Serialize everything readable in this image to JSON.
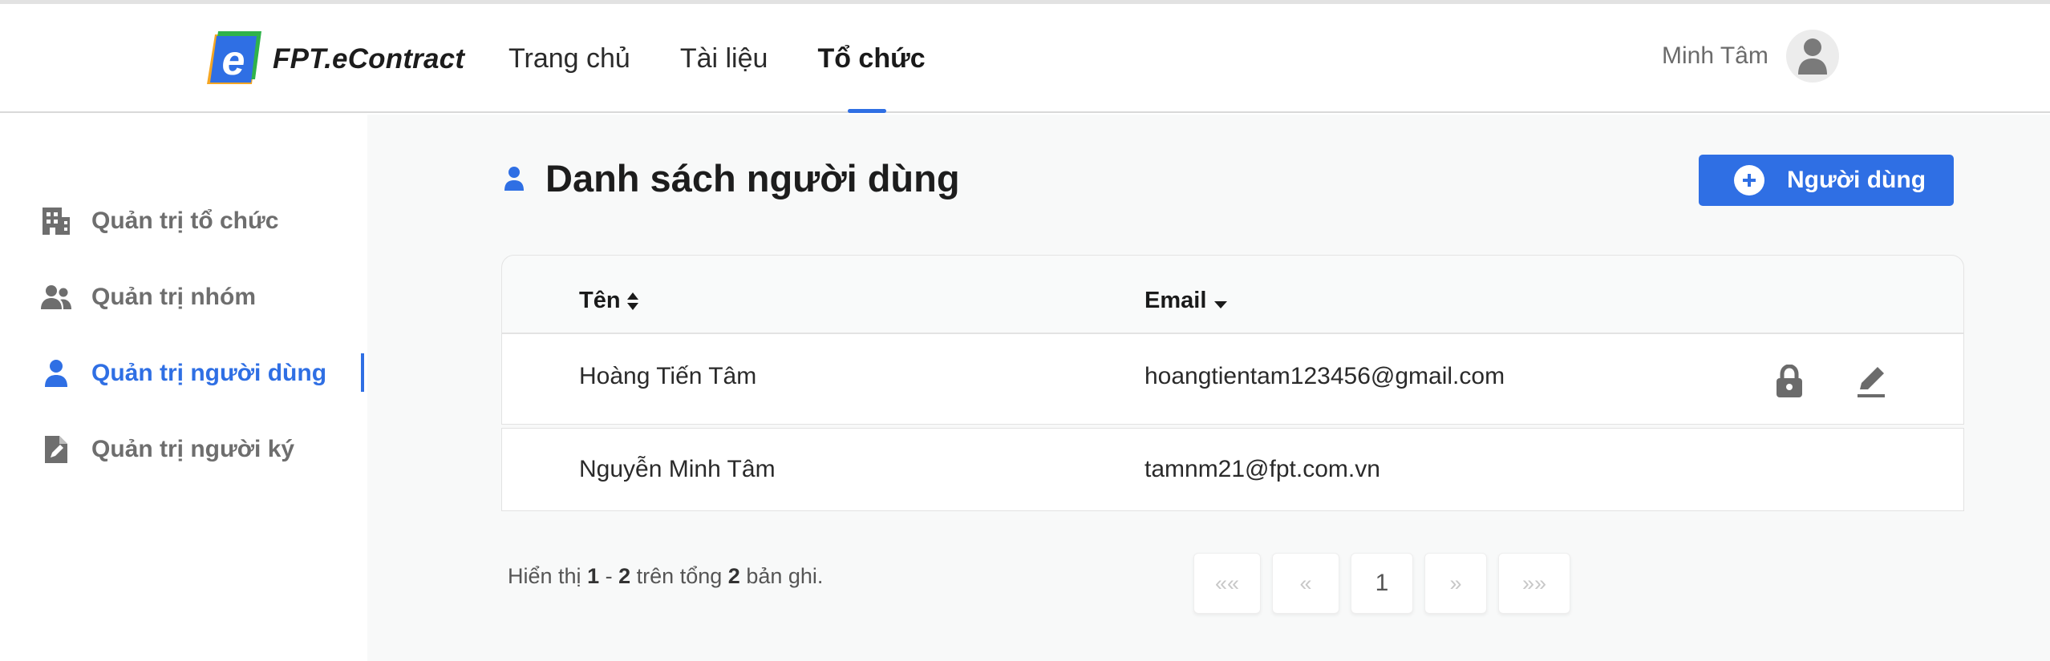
{
  "header": {
    "brand": "FPT.eContract",
    "nav": [
      {
        "label": "Trang chủ"
      },
      {
        "label": "Tài liệu"
      },
      {
        "label": "Tổ chức"
      }
    ],
    "user_name": "Minh Tâm"
  },
  "sidebar": {
    "items": [
      {
        "label": "Quản trị tổ chức",
        "icon": "building-icon"
      },
      {
        "label": "Quản trị nhóm",
        "icon": "users-icon"
      },
      {
        "label": "Quản trị người dùng",
        "icon": "user-icon"
      },
      {
        "label": "Quản trị người ký",
        "icon": "file-signature-icon"
      }
    ],
    "active_index": 2
  },
  "main": {
    "title": "Danh sách người dùng",
    "add_button": "Người dùng",
    "table": {
      "columns": [
        {
          "label": "Tên",
          "sort": "both"
        },
        {
          "label": "Email",
          "sort": "desc"
        }
      ],
      "rows": [
        {
          "name": "Hoàng Tiến Tâm",
          "email": "hoangtientam123456@gmail.com"
        },
        {
          "name": "Nguyễn Minh Tâm",
          "email": "tamnm21@fpt.com.vn"
        }
      ]
    },
    "summary": {
      "prefix": "Hiển thị",
      "from": "1",
      "dash": "-",
      "to": "2",
      "middle": "trên tổng",
      "total": "2",
      "suffix": "bản ghi."
    },
    "pagination": {
      "first": "««",
      "prev": "«",
      "current": "1",
      "next": "»",
      "last": "»»"
    }
  },
  "colors": {
    "accent": "#2f6fe4",
    "sidebar_text": "#6e6e6e",
    "main_bg": "#f8f9f9"
  }
}
